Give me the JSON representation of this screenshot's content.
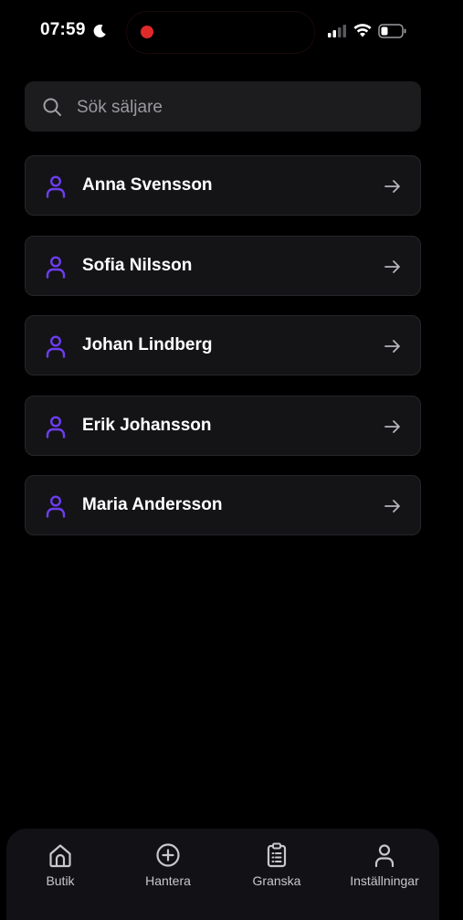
{
  "status_bar": {
    "time": "07:59",
    "recording": true
  },
  "search": {
    "placeholder": "Sök säljare",
    "value": ""
  },
  "sellers": [
    {
      "name": "Anna Svensson"
    },
    {
      "name": "Sofia Nilsson"
    },
    {
      "name": "Johan Lindberg"
    },
    {
      "name": "Erik Johansson"
    },
    {
      "name": "Maria Andersson"
    }
  ],
  "tab_bar": {
    "items": [
      {
        "label": "Butik",
        "icon": "home-icon"
      },
      {
        "label": "Hantera",
        "icon": "plus-circle-icon"
      },
      {
        "label": "Granska",
        "icon": "clipboard-icon"
      },
      {
        "label": "Inställningar",
        "icon": "user-icon"
      }
    ]
  },
  "colors": {
    "accent": "#6d3df0",
    "background": "#000000",
    "card": "#141416"
  }
}
